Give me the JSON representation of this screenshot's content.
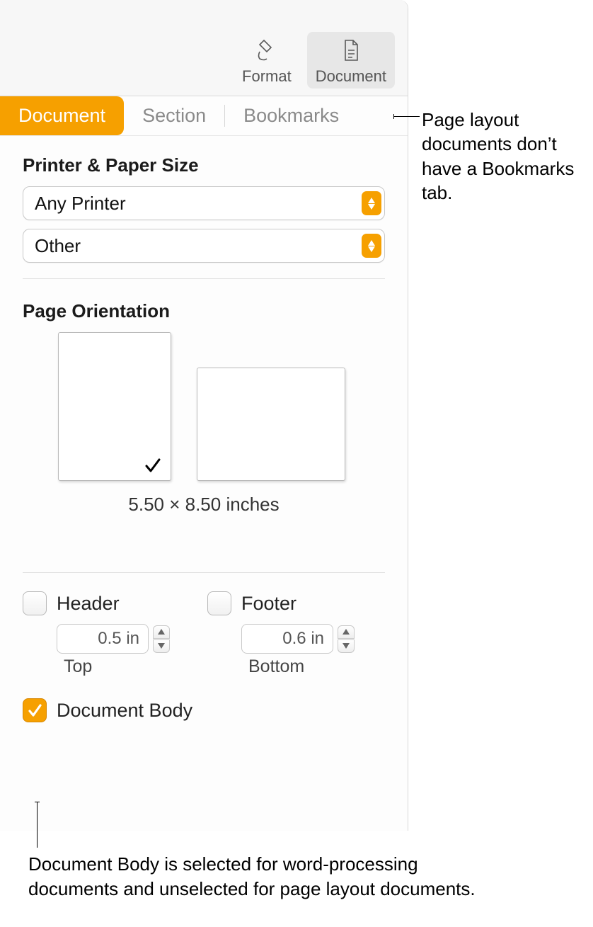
{
  "toolbar": {
    "format_label": "Format",
    "document_label": "Document"
  },
  "subtabs": {
    "document": "Document",
    "section": "Section",
    "bookmarks": "Bookmarks"
  },
  "printer_section": {
    "title": "Printer & Paper Size",
    "printer_value": "Any Printer",
    "paper_value": "Other"
  },
  "orientation": {
    "title": "Page Orientation",
    "dimensions": "5.50 × 8.50 inches"
  },
  "header_footer": {
    "header_label": "Header",
    "header_value": "0.5 in",
    "header_position": "Top",
    "footer_label": "Footer",
    "footer_value": "0.6 in",
    "footer_position": "Bottom"
  },
  "document_body": {
    "label": "Document Body",
    "checked": true
  },
  "callouts": {
    "bookmarks": "Page layout documents don’t have a Bookmarks tab.",
    "docbody": "Document Body is selected for word-processing documents and unselected for page layout documents."
  }
}
